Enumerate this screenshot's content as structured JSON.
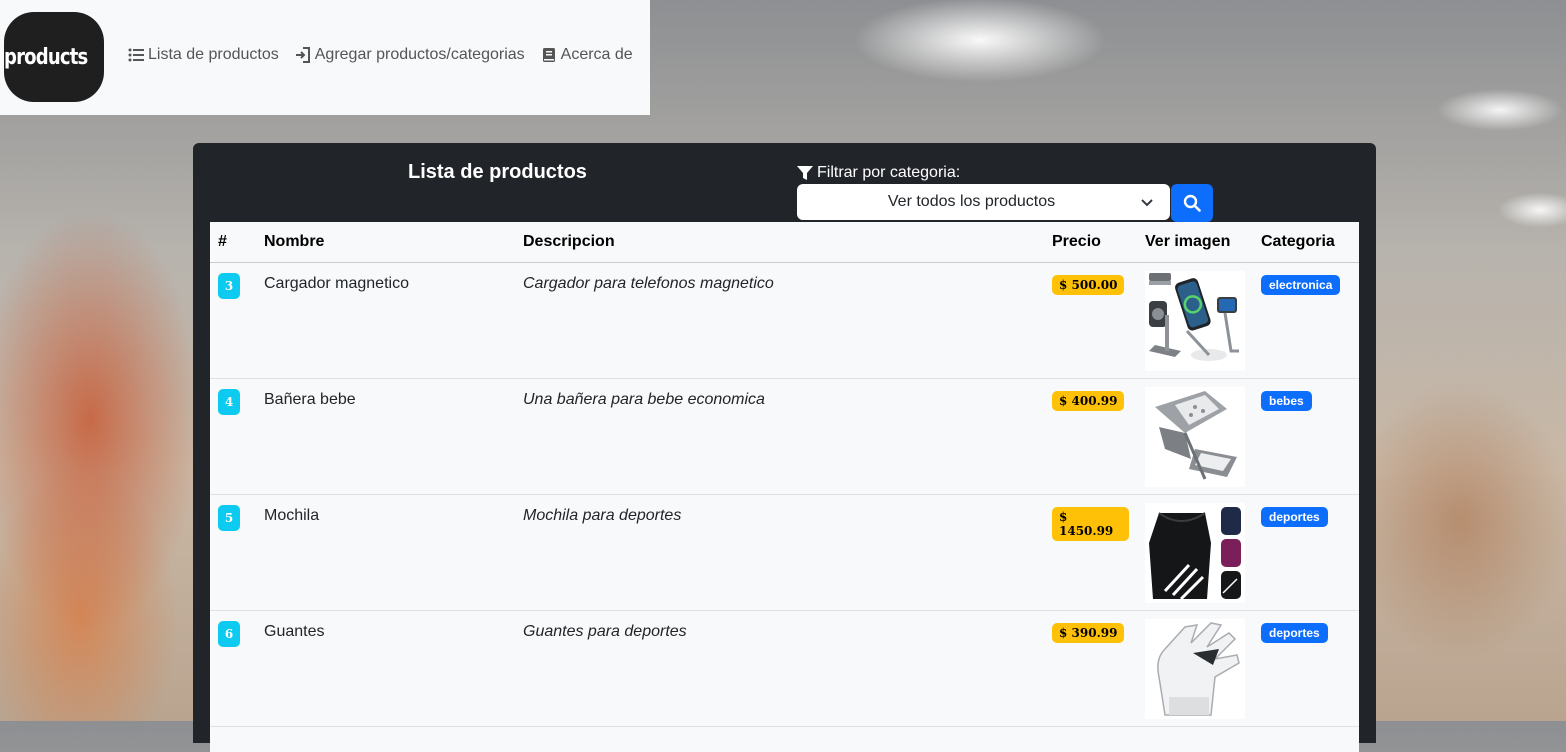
{
  "nav": {
    "logo_text": "products",
    "links": [
      {
        "label": "Lista de productos",
        "icon": "list-icon"
      },
      {
        "label": "Agregar productos/categorias",
        "icon": "sign-in-icon"
      },
      {
        "label": "Acerca de",
        "icon": "book-icon"
      }
    ]
  },
  "panel": {
    "title": "Lista de productos",
    "filter_label": "Filtrar por categoria:",
    "filter_selected": "Ver todos los productos"
  },
  "table": {
    "headers": [
      "#",
      "Nombre",
      "Descripcion",
      "Precio",
      "Ver imagen",
      "Categoria"
    ],
    "rows": [
      {
        "id": "3",
        "name": "Cargador magnetico",
        "description": "Cargador para telefonos magnetico",
        "price": "$ 500.00",
        "category": "electronica",
        "image": "charger-image"
      },
      {
        "id": "4",
        "name": "Bañera bebe",
        "description": "Una bañera para bebe economica",
        "price": "$ 400.99",
        "category": "bebes",
        "image": "baby-tub-image"
      },
      {
        "id": "5",
        "name": "Mochila",
        "description": "Mochila para deportes",
        "price": "$ 1450.99",
        "category": "deportes",
        "image": "backpack-image"
      },
      {
        "id": "6",
        "name": "Guantes",
        "description": "Guantes para deportes",
        "price": "$ 390.99",
        "category": "deportes",
        "image": "glove-image"
      }
    ]
  },
  "colors": {
    "info": "#0dcaf0",
    "warning": "#ffc107",
    "primary": "#0d6efd",
    "dark": "#212529"
  }
}
